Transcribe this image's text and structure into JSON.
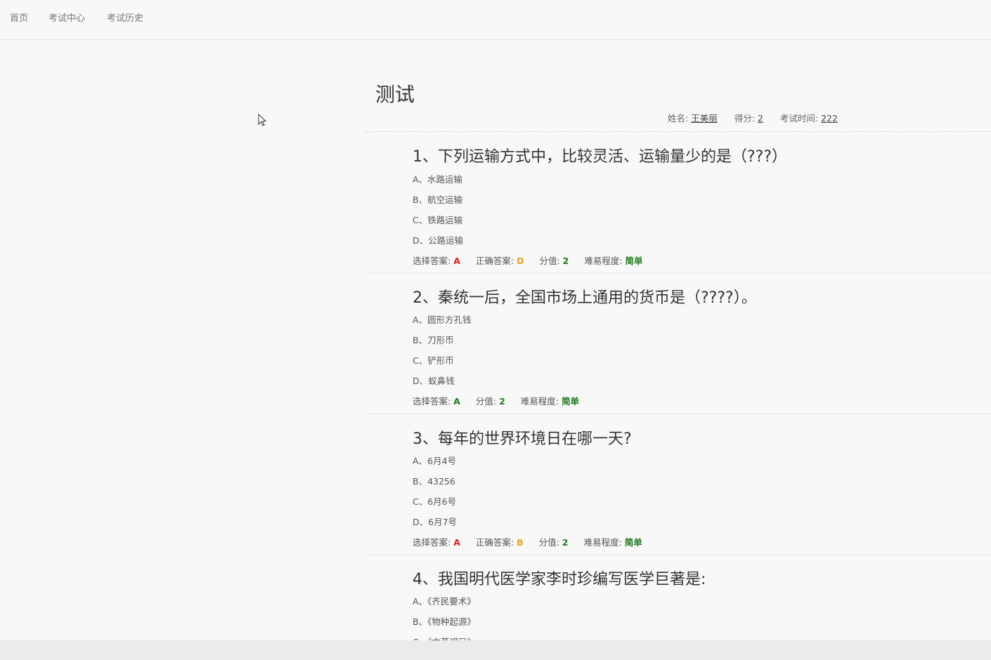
{
  "nav": {
    "items": [
      "首页",
      "考试中心",
      "考试历史"
    ]
  },
  "exam": {
    "title": "测试",
    "name_label": "姓名:",
    "name_value": "王美丽",
    "score_label": "得分:",
    "score_value": "2",
    "time_label": "考试时间:",
    "time_value": "222"
  },
  "labels": {
    "selected": "选择答案:",
    "correct": "正确答案:",
    "points": "分值:",
    "difficulty": "难易程度:"
  },
  "questions": [
    {
      "title": "1、下列运输方式中，比较灵活、运输量少的是（???）",
      "options": [
        "A、水路运输",
        "B、航空运输",
        "C、铁路运输",
        "D、公路运输"
      ],
      "selected": "A",
      "correct": "D",
      "points": "2",
      "difficulty": "简单"
    },
    {
      "title": "2、秦统一后，全国市场上通用的货币是（????）。",
      "options": [
        "A、圆形方孔钱",
        "B、刀形币",
        "C、铲形币",
        "D、蚁鼻钱"
      ],
      "selected": "A",
      "points": "2",
      "difficulty": "简单"
    },
    {
      "title": "3、每年的世界环境日在哪一天?",
      "options": [
        "A、6月4号",
        "B、43256",
        "C、6月6号",
        "D、6月7号"
      ],
      "selected": "A",
      "correct": "B",
      "points": "2",
      "difficulty": "简单"
    },
    {
      "title": "4、我国明代医学家李时珍编写医学巨著是:",
      "options": [
        "A、《齐民要术》",
        "B、《物种起源》",
        "C、《本草纲目》"
      ]
    }
  ],
  "colors": {
    "wrong": "#e02020",
    "right": "#1f7a1f",
    "correct_answer": "#f0a020"
  }
}
